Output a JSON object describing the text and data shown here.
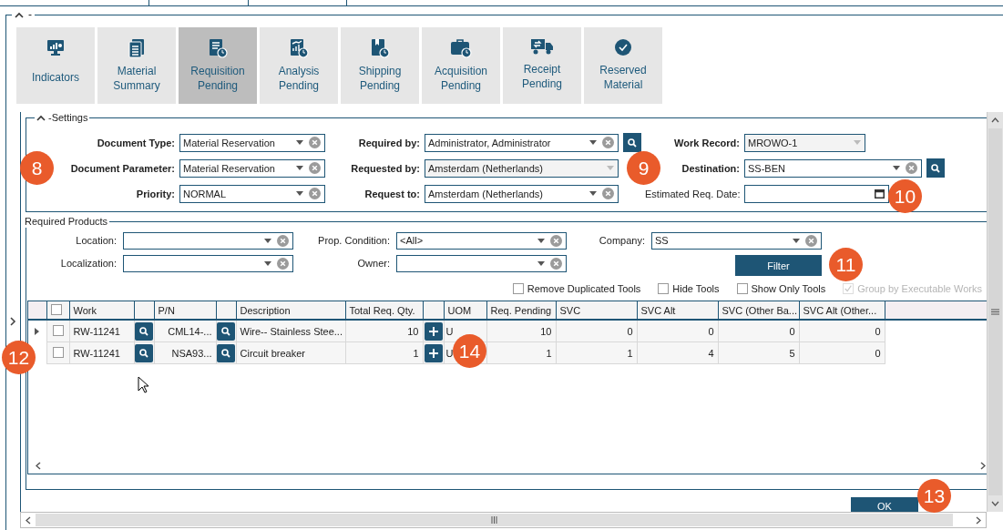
{
  "frame": {
    "label": "-",
    "expanded": true
  },
  "toolbar": [
    {
      "label": "Indicators",
      "selected": false
    },
    {
      "label": "Material Summary",
      "selected": false
    },
    {
      "label": "Requisition Pending",
      "selected": true
    },
    {
      "label": "Analysis Pending",
      "selected": false
    },
    {
      "label": "Shipping Pending",
      "selected": false
    },
    {
      "label": "Acquisition Pending",
      "selected": false
    },
    {
      "label": "Receipt Pending",
      "selected": false
    },
    {
      "label": "Reserved Material",
      "selected": false
    }
  ],
  "settings": {
    "label": "-Settings",
    "expanded": true,
    "columns": [
      [
        {
          "label": "Document Type:",
          "value": "Material Reservation",
          "kind": "combo",
          "bold": true,
          "search": false
        },
        {
          "label": "Document Parameter:",
          "value": "Material Reservation",
          "kind": "combo",
          "bold": true,
          "search": false
        },
        {
          "label": "Priority:",
          "value": "NORMAL",
          "kind": "combo",
          "bold": true,
          "search": false
        }
      ],
      [
        {
          "label": "Required by:",
          "value": "Administrator, Administrator",
          "kind": "combo",
          "bold": true,
          "search": true
        },
        {
          "label": "Requested by:",
          "value": "Amsterdam (Netherlands)",
          "kind": "readonly",
          "bold": true,
          "search": false
        },
        {
          "label": "Request to:",
          "value": "Amsterdam (Netherlands)",
          "kind": "combo",
          "bold": true,
          "search": false
        }
      ],
      [
        {
          "label": "Work Record:",
          "value": "MROWO-1",
          "kind": "readonly",
          "bold": true,
          "search": false
        },
        {
          "label": "Destination:",
          "value": "SS-BEN",
          "kind": "combo",
          "bold": true,
          "search": true
        },
        {
          "label": "Estimated Req. Date:",
          "kind": "date",
          "bold": false,
          "search": false
        }
      ]
    ]
  },
  "required_products": {
    "label": "Required Products",
    "filters": [
      [
        {
          "label": "Location:",
          "kind": "combo"
        },
        {
          "label": "Localization:",
          "kind": "combo"
        }
      ],
      [
        {
          "label": "Prop. Condition:",
          "value": "<All>",
          "kind": "combo"
        },
        {
          "label": "Owner:",
          "kind": "combo"
        }
      ],
      [
        {
          "label": "Company:",
          "value": "SS",
          "kind": "combo"
        }
      ]
    ],
    "filter_button": "Filter",
    "options": [
      {
        "label": "Remove Duplicated Tools",
        "checked": false,
        "disabled": false
      },
      {
        "label": "Hide Tools",
        "checked": false,
        "disabled": false
      },
      {
        "label": "Show Only Tools",
        "checked": false,
        "disabled": false
      },
      {
        "label": "Group by Executable Works",
        "checked": true,
        "disabled": true
      }
    ],
    "table": {
      "columns": [
        {
          "kind": "check",
          "checked": false
        },
        {
          "label": "Work",
          "kind": "text"
        },
        {
          "kind": "icon"
        },
        {
          "label": "P/N",
          "kind": "text"
        },
        {
          "kind": "icon"
        },
        {
          "label": "Description",
          "kind": "text"
        },
        {
          "label": "Total Req. Qty.",
          "kind": "text"
        },
        {
          "kind": "icon"
        },
        {
          "label": "UOM",
          "kind": "text"
        },
        {
          "label": "Req. Pending",
          "kind": "text"
        },
        {
          "label": "SVC",
          "kind": "text"
        },
        {
          "label": "SVC Alt",
          "kind": "text"
        },
        {
          "label": "SVC (Other Ba...",
          "kind": "text"
        },
        {
          "label": "SVC Alt (Other...",
          "kind": "text"
        }
      ],
      "rows": [
        {
          "current": true,
          "checked": false,
          "work": "RW-11241",
          "pn": "CML14-...",
          "description": "Wire-- Stainless Stee...",
          "total_req_qty": "10",
          "uom": "U",
          "req_pending": "10",
          "svc": "0",
          "svc_alt": "0",
          "svc_other": "0",
          "svc_alt_other": "0"
        },
        {
          "current": false,
          "checked": false,
          "work": "RW-11241",
          "pn": "NSA93...",
          "description": "Circuit breaker",
          "total_req_qty": "1",
          "uom": "U",
          "req_pending": "1",
          "svc": "1",
          "svc_alt": "4",
          "svc_other": "5",
          "svc_alt_other": "0"
        }
      ]
    }
  },
  "ok_button": "OK",
  "callouts": [
    "8",
    "9",
    "10",
    "11",
    "12",
    "13",
    "14"
  ]
}
